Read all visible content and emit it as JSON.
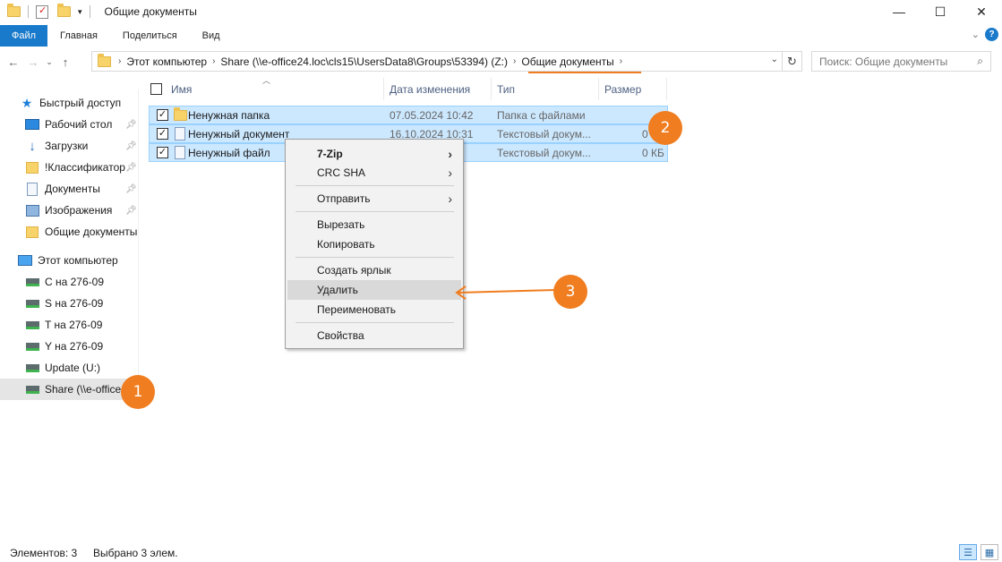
{
  "window": {
    "title": "Общие документы",
    "controls": [
      "—",
      "☐",
      "✕"
    ]
  },
  "ribbon": {
    "tabs": [
      "Файл",
      "Главная",
      "Поделиться",
      "Вид"
    ]
  },
  "address": {
    "crumbs": [
      "Этот компьютер",
      "Share (\\\\e-office24.loc\\cls15\\UsersData8\\Groups\\53394) (Z:)",
      "Общие документы"
    ],
    "search_placeholder": "Поиск: Общие документы"
  },
  "sidebar": {
    "items": [
      {
        "label": "Быстрый доступ",
        "icon": "star-icon"
      },
      {
        "label": "Рабочий стол",
        "icon": "desktop-icon",
        "pinned": true
      },
      {
        "label": "Загрузки",
        "icon": "download-icon",
        "pinned": true
      },
      {
        "label": "!Классификатор",
        "icon": "folder-icon",
        "pinned": true
      },
      {
        "label": "Документы",
        "icon": "documents-icon",
        "pinned": true
      },
      {
        "label": "Изображения",
        "icon": "pictures-icon",
        "pinned": true
      },
      {
        "label": "Общие документы",
        "icon": "folder-icon"
      },
      {
        "label": "Этот компьютер",
        "icon": "computer-icon"
      },
      {
        "label": "C на 276-09",
        "icon": "network-drive-icon"
      },
      {
        "label": "S на 276-09",
        "icon": "network-drive-icon"
      },
      {
        "label": "T на 276-09",
        "icon": "network-drive-icon"
      },
      {
        "label": "Y на 276-09",
        "icon": "network-drive-icon"
      },
      {
        "label": "Update (U:)",
        "icon": "network-drive-icon"
      },
      {
        "label": "Share (\\\\e-office",
        "icon": "network-drive-icon",
        "selected": true
      }
    ]
  },
  "columns": [
    "Имя",
    "Дата изменения",
    "Тип",
    "Размер"
  ],
  "files": [
    {
      "name": "Ненужная папка",
      "date": "07.05.2024 10:42",
      "type": "Папка с файлами",
      "size": "",
      "icon": "folder-icon"
    },
    {
      "name": "Ненужный документ",
      "date": "16.10.2024 10:31",
      "type": "Текстовый докум...",
      "size": "0",
      "icon": "document-icon"
    },
    {
      "name": "Ненужный файл",
      "date": "",
      "type": "Текстовый докум...",
      "size": "0 КБ",
      "icon": "document-icon"
    }
  ],
  "context_menu": {
    "items": [
      "7-Zip",
      "CRC SHA",
      "Отправить",
      "Вырезать",
      "Копировать",
      "Создать ярлык",
      "Удалить",
      "Переименовать",
      "Свойства"
    ],
    "highlighted": "Удалить"
  },
  "badges": [
    "1",
    "2",
    "3"
  ],
  "status": {
    "count": "Элементов: 3",
    "selected": "Выбрано 3 элем."
  },
  "colors": {
    "accent": "#1979ca",
    "annotation": "#f07d1f",
    "selection": "#cce8ff"
  }
}
